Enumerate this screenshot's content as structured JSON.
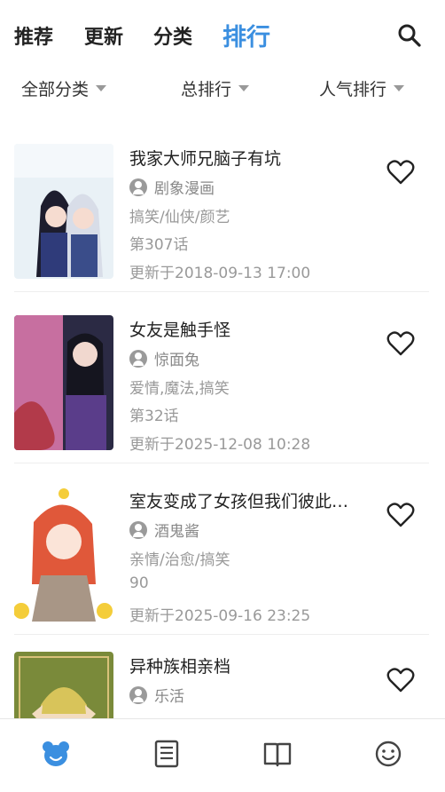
{
  "top_tabs": [
    "推荐",
    "更新",
    "分类",
    "排行"
  ],
  "active_tab": "排行",
  "filters": [
    {
      "label": "全部分类"
    },
    {
      "label": "总排行"
    },
    {
      "label": "人气排行"
    }
  ],
  "comics": [
    {
      "title": "我家大师兄脑子有坑",
      "author": "剧象漫画",
      "tags": "搞笑/仙侠/颜艺",
      "chapter": "第307话",
      "updated": "更新于2018-09-13 17:00"
    },
    {
      "title": "女友是触手怪",
      "author": "惊面兔",
      "tags": "爱情,魔法,搞笑",
      "chapter": "第32话",
      "updated": "更新于2025-12-08 10:28"
    },
    {
      "title": "室友变成了女孩但我们彼此…",
      "author": "酒鬼酱",
      "tags": "亲情/治愈/搞笑",
      "chapter": "90",
      "updated": "更新于2025-09-16 23:25"
    },
    {
      "title": "异种族相亲档",
      "author": "乐活",
      "tags": "",
      "chapter": "",
      "updated": ""
    }
  ],
  "colors": {
    "accent": "#3b8fe0",
    "text": "#222222",
    "muted": "#999999"
  },
  "bottom_nav_icons": [
    "bear-home-icon",
    "document-icon",
    "book-icon",
    "smiley-icon"
  ]
}
